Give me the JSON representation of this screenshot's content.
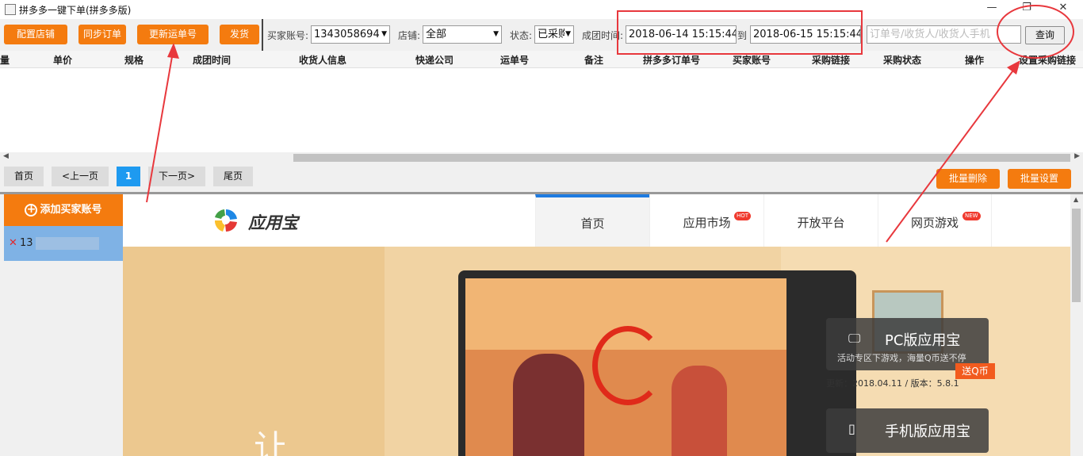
{
  "window": {
    "title": "拼多多一键下单(拼多多版)",
    "controls": [
      "—",
      "❐",
      "✕"
    ]
  },
  "toolbar": {
    "config_store": "配置店铺",
    "sync_orders": "同步订单",
    "update_tracking": "更新运单号",
    "ship": "发货",
    "buyer_account_label": "买家账号:",
    "buyer_account_value": "1343058694",
    "store_label": "店铺:",
    "store_value": "全部",
    "status_label": "状态:",
    "status_value": "已采购",
    "group_time_label": "成团时间:",
    "time_from": "2018-06-14 15:15:44",
    "to_label": "到",
    "time_to": "2018-06-15 15:15:44",
    "search_placeholder": "订单号/收货人/收货人手机",
    "query": "查询"
  },
  "table": {
    "columns": [
      "量",
      "单价",
      "规格",
      "成团时间",
      "收货人信息",
      "快递公司",
      "运单号",
      "备注",
      "拼多多订单号",
      "买家账号",
      "采购链接",
      "采购状态",
      "操作",
      "设置采购链接"
    ]
  },
  "pager": {
    "first": "首页",
    "prev": "<上一页",
    "current": "1",
    "next": "下一页>",
    "last": "尾页",
    "batch_delete": "批量删除",
    "batch_settings": "批量设置"
  },
  "left": {
    "add_buyer": "添加买家账号",
    "account_prefix": "13",
    "remove_icon": "✕"
  },
  "web": {
    "brand": "应用宝",
    "nav": [
      {
        "label": "首页",
        "badge": ""
      },
      {
        "label": "应用市场",
        "badge": "HOT"
      },
      {
        "label": "开放平台",
        "badge": ""
      },
      {
        "label": "网页游戏",
        "badge": "NEW"
      }
    ],
    "pc_title": "PC版应用宝",
    "pc_sub": "活动专区下游戏，海量Q币送不停",
    "send_q": "送Q币",
    "update_info": "更新：2018.04.11 / 版本：5.8.1",
    "mobile_title": "手机版应用宝",
    "hero_text": "让"
  },
  "colors": {
    "accent_orange": "#f47b0f",
    "page_blue": "#1e9af0",
    "annotation_red": "#e8383d"
  }
}
